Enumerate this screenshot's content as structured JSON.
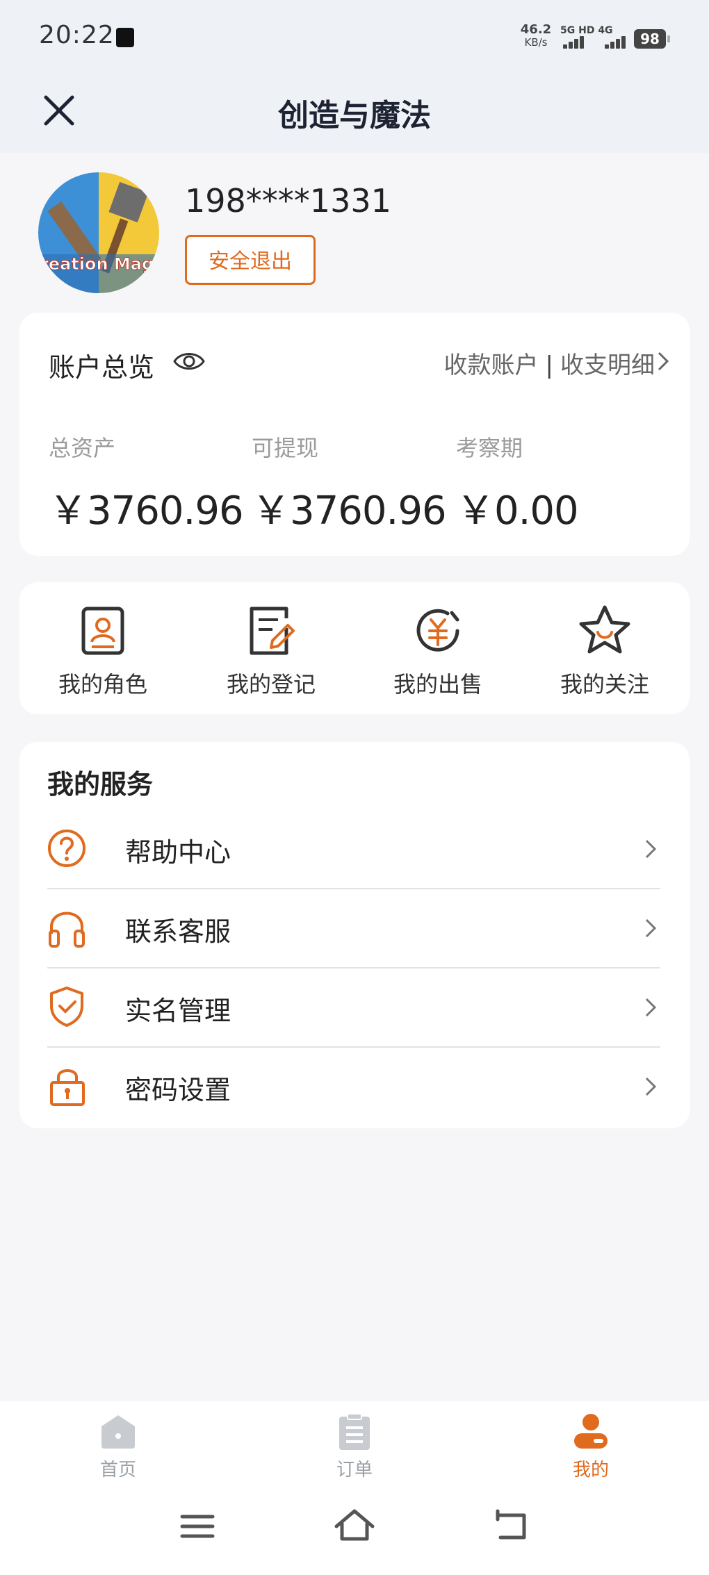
{
  "status_bar": {
    "time": "20:22",
    "net_speed": "46.2",
    "net_speed_unit": "KB/s",
    "network_label": "5G HD 4G",
    "battery": "98"
  },
  "header": {
    "title": "创造与魔法",
    "close_icon": "close-icon"
  },
  "profile": {
    "avatar_text": "Creation Magic",
    "phone": "198****1331",
    "logout_label": "安全退出"
  },
  "account": {
    "title": "账户总览",
    "eye_icon": "eye-icon",
    "link_accounts": "收款账户",
    "link_separator": "|",
    "link_details": "收支明细",
    "cells": [
      {
        "label": "总资产",
        "value": "￥3760.96"
      },
      {
        "label": "可提现",
        "value": "￥3760.96"
      },
      {
        "label": "考察期",
        "value": "￥0.00"
      }
    ]
  },
  "quick_actions": [
    {
      "label": "我的角色",
      "icon": "id-card-icon"
    },
    {
      "label": "我的登记",
      "icon": "edit-note-icon"
    },
    {
      "label": "我的出售",
      "icon": "yuan-circle-icon"
    },
    {
      "label": "我的关注",
      "icon": "star-icon"
    }
  ],
  "services": {
    "title": "我的服务",
    "items": [
      {
        "label": "帮助中心",
        "icon": "help-icon"
      },
      {
        "label": "联系客服",
        "icon": "headset-icon"
      },
      {
        "label": "实名管理",
        "icon": "shield-check-icon"
      },
      {
        "label": "密码设置",
        "icon": "lock-icon"
      }
    ]
  },
  "tabbar": {
    "tabs": [
      {
        "label": "首页",
        "icon": "home-icon",
        "active": false
      },
      {
        "label": "订单",
        "icon": "order-icon",
        "active": false
      },
      {
        "label": "我的",
        "icon": "profile-icon",
        "active": true
      }
    ]
  },
  "colors": {
    "accent": "#e06a1e",
    "inactive": "#9aa0a6",
    "text": "#222222"
  }
}
